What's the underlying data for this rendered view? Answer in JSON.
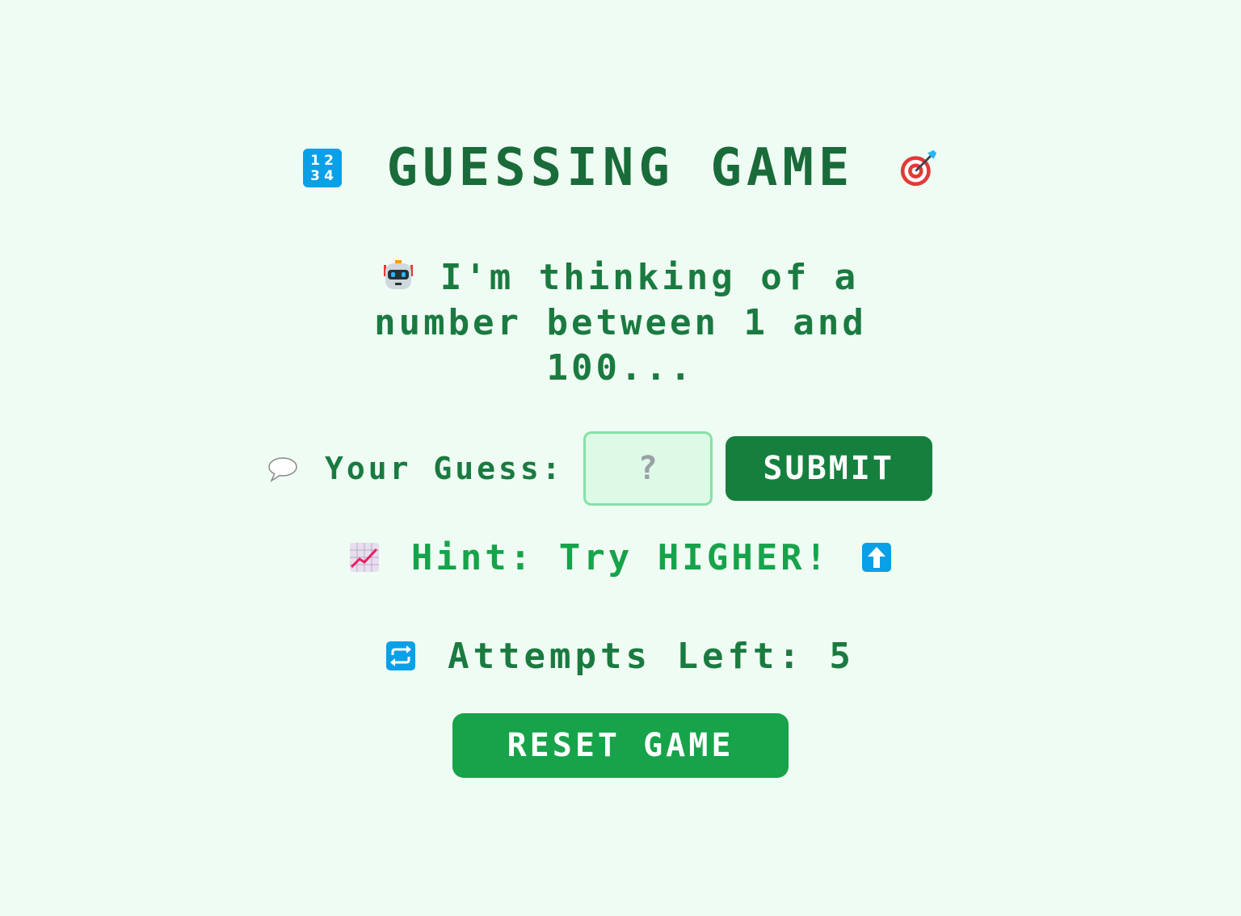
{
  "header": {
    "title": "GUESSING GAME",
    "left_icon": "keycap-1234-icon",
    "left_icon_digits": [
      "1",
      "2",
      "3",
      "4"
    ],
    "right_icon": "target-icon"
  },
  "message": {
    "icon": "robot-icon",
    "text": "I'm thinking of a number between 1 and 100..."
  },
  "guess": {
    "icon": "speech-bubble-icon",
    "label": "Your Guess:",
    "placeholder": "?",
    "value": "",
    "submit_label": "SUBMIT"
  },
  "hint": {
    "left_icon": "chart-increasing-icon",
    "text": "Hint: Try HIGHER!",
    "right_icon": "up-arrow-icon"
  },
  "attempts": {
    "icon": "repeat-icon",
    "text": "Attempts Left: 5"
  },
  "reset": {
    "label": "RESET GAME"
  },
  "colors": {
    "background": "#effcf3",
    "title": "#1a6b3a",
    "text": "#1a7a40",
    "hint": "#16a34a",
    "submit_bg": "#15803d",
    "reset_bg": "#16a34a",
    "input_bg": "#dcfae6",
    "input_border": "#86e0a6",
    "icon_blue": "#0aa0e8"
  }
}
